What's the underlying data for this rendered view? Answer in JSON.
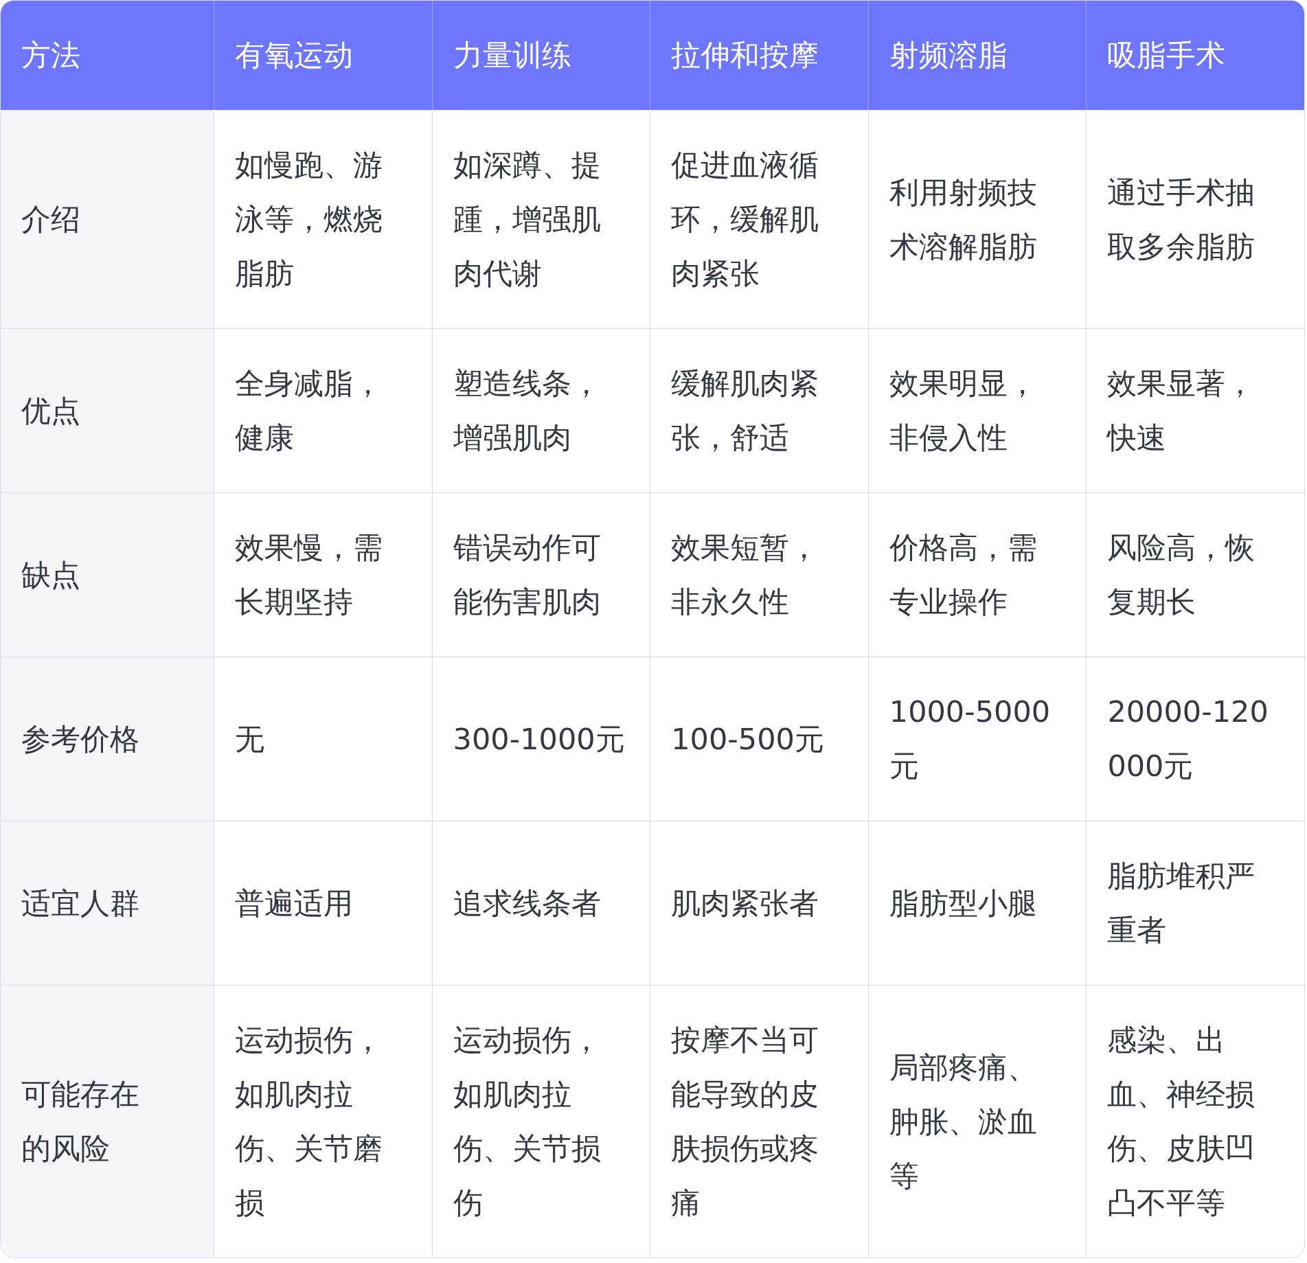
{
  "table": {
    "columns": [
      "方法",
      "有氧运动",
      "力量训练",
      "拉伸和按摩",
      "射频溶脂",
      "吸脂手术"
    ],
    "rows": [
      {
        "cells": [
          "介绍",
          "如慢跑、游泳等，燃烧脂肪",
          "如深蹲、提踵，增强肌肉代谢",
          "促进血液循环，缓解肌肉紧张",
          "利用射频技术溶解脂肪",
          "通过手术抽取多余脂肪"
        ]
      },
      {
        "cells": [
          "优点",
          "全身减脂，健康",
          "塑造线条，增强肌肉",
          "缓解肌肉紧张，舒适",
          "效果明显，非侵入性",
          "效果显著，快速"
        ]
      },
      {
        "cells": [
          "缺点",
          "效果慢，需长期坚持",
          "错误动作可能伤害肌肉",
          "效果短暂，非永久性",
          "价格高，需专业操作",
          "风险高，恢复期长"
        ]
      },
      {
        "cells": [
          "参考价格",
          "无",
          "300-1000元",
          "100-500元",
          "1000-5000元",
          "20000-120000元"
        ]
      },
      {
        "cells": [
          "适宜人群",
          "普遍适用",
          "追求线条者",
          "肌肉紧张者",
          "脂肪型小腿",
          "脂肪堆积严重者"
        ]
      },
      {
        "cells": [
          "可能存在的风险",
          "运动损伤，如肌肉拉伤、关节磨损",
          "运动损伤，如肌肉拉伤、关节损伤",
          "按摩不当可能导致的皮肤损伤或疼痛",
          "局部疼痛、肿胀、淤血等",
          "感染、出血、神经损伤、皮肤凹凸不平等"
        ]
      }
    ]
  }
}
